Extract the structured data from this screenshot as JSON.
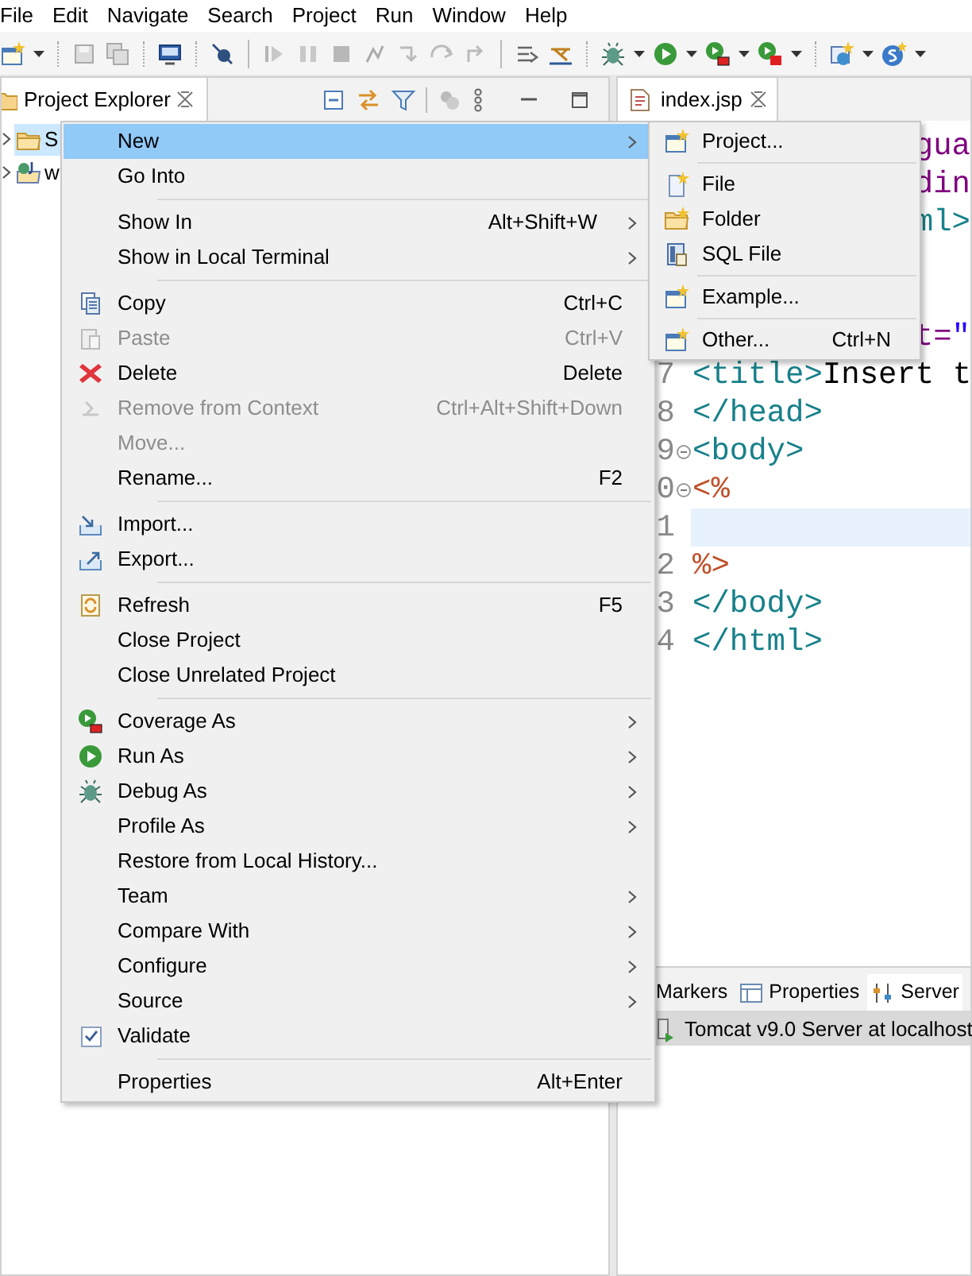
{
  "menu_bar": [
    "File",
    "Edit",
    "Navigate",
    "Search",
    "Project",
    "Run",
    "Window",
    "Help"
  ],
  "project_explorer": {
    "title": "Project Explorer",
    "tree": [
      {
        "label": "S",
        "selected": true
      },
      {
        "label": "w",
        "selected": false
      }
    ]
  },
  "editor": {
    "tab": "index.jsp",
    "lines": [
      {
        "kind": "fragment",
        "current": false,
        "segments": [
          {
            "kind": "attr",
            "text": "gua"
          }
        ]
      },
      {
        "kind": "fragment",
        "current": false,
        "segments": [
          {
            "kind": "attr",
            "text": "din"
          }
        ]
      },
      {
        "kind": "fragment",
        "current": false,
        "segments": [
          {
            "kind": "tag",
            "text": "ml>"
          }
        ]
      },
      {
        "kind": "blank",
        "current": false
      },
      {
        "kind": "blank",
        "current": false
      },
      {
        "kind": "fragment",
        "current": false,
        "segments": [
          {
            "kind": "attr",
            "text": "t="
          },
          {
            "kind": "string",
            "text": "\""
          }
        ]
      },
      {
        "kind": "full",
        "number": "7",
        "current": false,
        "foldable": false,
        "segments": [
          {
            "kind": "tag",
            "text": "<title>"
          },
          {
            "kind": "text",
            "text": "Insert t"
          }
        ]
      },
      {
        "kind": "full",
        "number": "8",
        "current": false,
        "foldable": false,
        "segments": [
          {
            "kind": "tag",
            "text": "</head>"
          }
        ]
      },
      {
        "kind": "full",
        "number": "9",
        "current": false,
        "foldable": true,
        "segments": [
          {
            "kind": "tag",
            "text": "<body>"
          }
        ]
      },
      {
        "kind": "full",
        "number": "0",
        "current": false,
        "foldable": true,
        "segments": [
          {
            "kind": "scriptlet",
            "text": "<%"
          }
        ]
      },
      {
        "kind": "full",
        "number": "1",
        "current": true,
        "foldable": false
      },
      {
        "kind": "full",
        "number": "2",
        "current": false,
        "foldable": false,
        "segments": [
          {
            "kind": "scriptlet",
            "text": "%>"
          }
        ]
      },
      {
        "kind": "full",
        "number": "3",
        "current": false,
        "foldable": false,
        "segments": [
          {
            "kind": "tag",
            "text": "</body>"
          }
        ]
      },
      {
        "kind": "full",
        "number": "4",
        "current": false,
        "foldable": false,
        "segments": [
          {
            "kind": "tag",
            "text": "</html>"
          }
        ]
      }
    ]
  },
  "bottom_panel": {
    "tabs": [
      {
        "label": "Markers",
        "selected": false
      },
      {
        "label": "Properties",
        "selected": false
      },
      {
        "label": "Server",
        "selected": true
      }
    ],
    "rows": [
      {
        "label": "Tomcat v9.0 Server at localhost",
        "selected": true
      }
    ]
  },
  "context_menu": {
    "items": [
      {
        "kind": "item",
        "label": "New",
        "submenu": true,
        "disabled": false,
        "selected": true,
        "checked": false
      },
      {
        "kind": "item",
        "label": "Go Into",
        "submenu": false,
        "disabled": false,
        "selected": false,
        "checked": false
      },
      {
        "kind": "separator"
      },
      {
        "kind": "item",
        "label": "Show In",
        "shortcut": "Alt+Shift+W",
        "submenu": true,
        "disabled": false,
        "selected": false,
        "checked": false
      },
      {
        "kind": "item",
        "label": "Show in Local Terminal",
        "submenu": true,
        "disabled": false,
        "selected": false,
        "checked": false
      },
      {
        "kind": "separator"
      },
      {
        "kind": "item",
        "label": "Copy",
        "shortcut": "Ctrl+C",
        "submenu": false,
        "disabled": false,
        "selected": false,
        "checked": false
      },
      {
        "kind": "item",
        "label": "Paste",
        "shortcut": "Ctrl+V",
        "submenu": false,
        "disabled": true,
        "selected": false,
        "checked": false
      },
      {
        "kind": "item",
        "label": "Delete",
        "shortcut": "Delete",
        "submenu": false,
        "disabled": false,
        "selected": false,
        "checked": false
      },
      {
        "kind": "item",
        "label": "Remove from Context",
        "shortcut": "Ctrl+Alt+Shift+Down",
        "submenu": false,
        "disabled": true,
        "selected": false,
        "checked": false
      },
      {
        "kind": "item",
        "label": "Move...",
        "submenu": false,
        "disabled": true,
        "selected": false,
        "checked": false
      },
      {
        "kind": "item",
        "label": "Rename...",
        "shortcut": "F2",
        "submenu": false,
        "disabled": false,
        "selected": false,
        "checked": false
      },
      {
        "kind": "separator"
      },
      {
        "kind": "item",
        "label": "Import...",
        "submenu": false,
        "disabled": false,
        "selected": false,
        "checked": false
      },
      {
        "kind": "item",
        "label": "Export...",
        "submenu": false,
        "disabled": false,
        "selected": false,
        "checked": false
      },
      {
        "kind": "separator"
      },
      {
        "kind": "item",
        "label": "Refresh",
        "shortcut": "F5",
        "submenu": false,
        "disabled": false,
        "selected": false,
        "checked": false
      },
      {
        "kind": "item",
        "label": "Close Project",
        "submenu": false,
        "disabled": false,
        "selected": false,
        "checked": false
      },
      {
        "kind": "item",
        "label": "Close Unrelated Project",
        "submenu": false,
        "disabled": false,
        "selected": false,
        "checked": false
      },
      {
        "kind": "separator"
      },
      {
        "kind": "item",
        "label": "Coverage As",
        "submenu": true,
        "disabled": false,
        "selected": false,
        "checked": false
      },
      {
        "kind": "item",
        "label": "Run As",
        "submenu": true,
        "disabled": false,
        "selected": false,
        "checked": false
      },
      {
        "kind": "item",
        "label": "Debug As",
        "submenu": true,
        "disabled": false,
        "selected": false,
        "checked": false
      },
      {
        "kind": "item",
        "label": "Profile As",
        "submenu": true,
        "disabled": false,
        "selected": false,
        "checked": false
      },
      {
        "kind": "item",
        "label": "Restore from Local History...",
        "submenu": false,
        "disabled": false,
        "selected": false,
        "checked": false
      },
      {
        "kind": "item",
        "label": "Team",
        "submenu": true,
        "disabled": false,
        "selected": false,
        "checked": false
      },
      {
        "kind": "item",
        "label": "Compare With",
        "submenu": true,
        "disabled": false,
        "selected": false,
        "checked": false
      },
      {
        "kind": "item",
        "label": "Configure",
        "submenu": true,
        "disabled": false,
        "selected": false,
        "checked": false
      },
      {
        "kind": "item",
        "label": "Source",
        "submenu": true,
        "disabled": false,
        "selected": false,
        "checked": false
      },
      {
        "kind": "item",
        "label": "Validate",
        "submenu": false,
        "disabled": false,
        "selected": false,
        "checked": true
      },
      {
        "kind": "separator"
      },
      {
        "kind": "item",
        "label": "Properties",
        "shortcut": "Alt+Enter",
        "submenu": false,
        "disabled": false,
        "selected": false,
        "checked": false
      }
    ]
  },
  "new_submenu": {
    "items": [
      {
        "kind": "item",
        "label": "Project...",
        "disabled": false,
        "selected": false
      },
      {
        "kind": "separator"
      },
      {
        "kind": "item",
        "label": "File",
        "disabled": false,
        "selected": false
      },
      {
        "kind": "item",
        "label": "Folder",
        "disabled": false,
        "selected": false
      },
      {
        "kind": "item",
        "label": "SQL File",
        "disabled": false,
        "selected": false
      },
      {
        "kind": "separator"
      },
      {
        "kind": "item",
        "label": "Example...",
        "disabled": false,
        "selected": false
      },
      {
        "kind": "separator"
      },
      {
        "kind": "item",
        "label": "Other...",
        "shortcut": "Ctrl+N",
        "disabled": false,
        "selected": false
      }
    ]
  }
}
